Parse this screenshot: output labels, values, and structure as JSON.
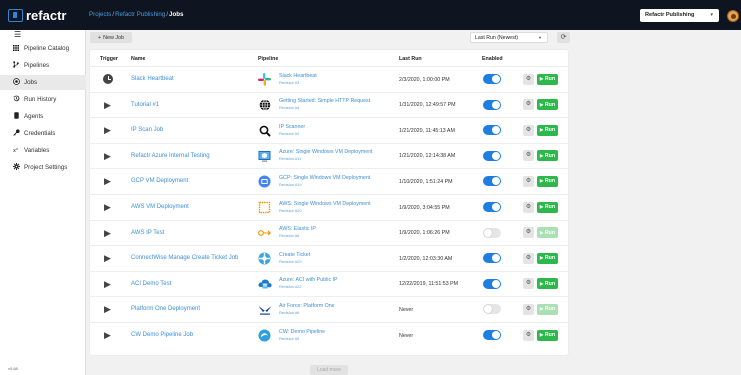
{
  "app": {
    "brand": "refactr"
  },
  "breadcrumb": {
    "projects": "Projects",
    "project": "Refactr Publishing",
    "current": "Jobs"
  },
  "org_selector": {
    "value": "Refactr Publishing"
  },
  "sidebar": {
    "items": [
      {
        "label": "Pipeline Catalog",
        "icon": "grid-icon"
      },
      {
        "label": "Pipelines",
        "icon": "branch-icon"
      },
      {
        "label": "Jobs",
        "icon": "target-icon",
        "active": true
      },
      {
        "label": "Run History",
        "icon": "history-icon"
      },
      {
        "label": "Agents",
        "icon": "device-icon"
      },
      {
        "label": "Credentials",
        "icon": "key-icon"
      },
      {
        "label": "Variables",
        "icon": "variables-icon"
      },
      {
        "label": "Project Settings",
        "icon": "gear-icon"
      }
    ],
    "version": "v0.68"
  },
  "toolbar": {
    "new_job": "New Job",
    "sort": "Last Run (Newest)"
  },
  "table": {
    "headers": {
      "trigger": "Trigger",
      "name": "Name",
      "pipeline": "Pipeline",
      "last_run": "Last Run",
      "enabled": "Enabled"
    },
    "run_label": "Run",
    "rows": [
      {
        "trigger": "schedule",
        "name": "Slack Heartbeat",
        "pipeline": "Slack Heartbeat",
        "revision": "Revision #3",
        "last_run": "2/3/2020, 1:00:00 PM",
        "enabled": true,
        "icon": "slack-logo"
      },
      {
        "trigger": "manual",
        "name": "Tutorial #1",
        "pipeline": "Getting Started: Simple HTTP Request",
        "revision": "Revision #4",
        "last_run": "1/31/2020, 12:49:57 PM",
        "enabled": true,
        "icon": "globe-icon"
      },
      {
        "trigger": "manual",
        "name": "IP Scan Job",
        "pipeline": "IP Scanner",
        "revision": "Revision #2",
        "last_run": "1/21/2020, 11:45:13 AM",
        "enabled": true,
        "icon": "magnifier-icon"
      },
      {
        "trigger": "manual",
        "name": "Refactr Azure Internal Testing",
        "pipeline": "Azure: Single Windows VM Deployment",
        "revision": "Revision #11",
        "last_run": "1/21/2020, 12:14:38 AM",
        "enabled": true,
        "icon": "azure-vm-icon"
      },
      {
        "trigger": "manual",
        "name": "GCP VM Deployment",
        "pipeline": "GCP: Single Windows VM Deployment",
        "revision": "Revision #19",
        "last_run": "1/10/2020, 1:51:24 PM",
        "enabled": true,
        "icon": "gcp-icon"
      },
      {
        "trigger": "manual",
        "name": "AWS VM Deployment",
        "pipeline": "AWS: Single Windows VM Deployment",
        "revision": "Revision #20",
        "last_run": "1/9/2020, 3:04:55 PM",
        "enabled": true,
        "icon": "aws-ec2-icon"
      },
      {
        "trigger": "manual",
        "name": "AWS IP Test",
        "pipeline": "AWS: Elastic IP",
        "revision": "Revision #6",
        "last_run": "1/9/2020, 1:06:26 PM",
        "enabled": false,
        "icon": "elastic-ip-icon"
      },
      {
        "trigger": "manual",
        "name": "ConnectWise Manage Create Ticket Job",
        "pipeline": "Create Ticket",
        "revision": "Revision #29",
        "last_run": "1/2/2020, 12:03:30 AM",
        "enabled": true,
        "icon": "connectwise-icon"
      },
      {
        "trigger": "manual",
        "name": "ACI Demo Test",
        "pipeline": "Azure: ACI with Public IP",
        "revision": "Revision #22",
        "last_run": "12/22/2019, 11:51:53 PM",
        "enabled": true,
        "icon": "azure-aci-icon"
      },
      {
        "trigger": "manual",
        "name": "Platform One Deployment",
        "pipeline": "Air Force: Platform One",
        "revision": "Revision #6",
        "last_run": "Never",
        "enabled": false,
        "icon": "airforce-icon"
      },
      {
        "trigger": "manual",
        "name": "CW Demo Pipeline Job",
        "pipeline": "CW: Demo Pipeline",
        "revision": "Revision #5",
        "last_run": "Never",
        "enabled": true,
        "icon": "cw-icon"
      }
    ],
    "load_more": "Load more"
  },
  "colors": {
    "accent": "#1f7ee0",
    "link": "#3d8fd6",
    "run": "#2eb84b",
    "topbar": "#0f1520"
  }
}
